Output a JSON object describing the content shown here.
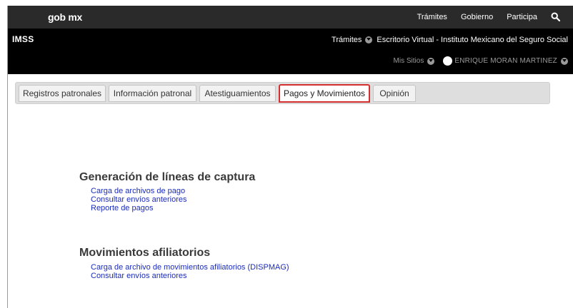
{
  "gov_bar": {
    "logo": "gob mx",
    "nav": [
      "Trámites",
      "Gobierno",
      "Participa"
    ],
    "search_icon": "search-icon"
  },
  "imss_header": {
    "title": "IMSS",
    "tramites": "Trámites",
    "portal": "Escritorio Virtual - Instituto Mexicano del Seguro Social",
    "mis_sitios": "Mis Sitios",
    "user_name": "ENRIQUE MORAN MARTINEZ"
  },
  "tabs": [
    {
      "label": "Registros patronales"
    },
    {
      "label": "Información patronal"
    },
    {
      "label": "Atestiguamientos"
    },
    {
      "label": "Pagos y Movimientos",
      "active": true
    },
    {
      "label": "Opinión"
    }
  ],
  "sections": [
    {
      "title": "Generación de líneas de captura",
      "links": [
        "Carga de archivos de pago",
        "Consultar envíos anteriores",
        "Reporte de pagos"
      ]
    },
    {
      "title": "Movimientos afiliatorios",
      "links": [
        "Carga de archivo de movimientos afiliatorios (DISPMAG)",
        "Consultar envíos anteriores"
      ]
    }
  ],
  "colors": {
    "gov_bar": "#2a2a2a",
    "imss_bar": "#000000",
    "active_tab_border": "#d32f2f",
    "link": "#1a2bbf"
  }
}
